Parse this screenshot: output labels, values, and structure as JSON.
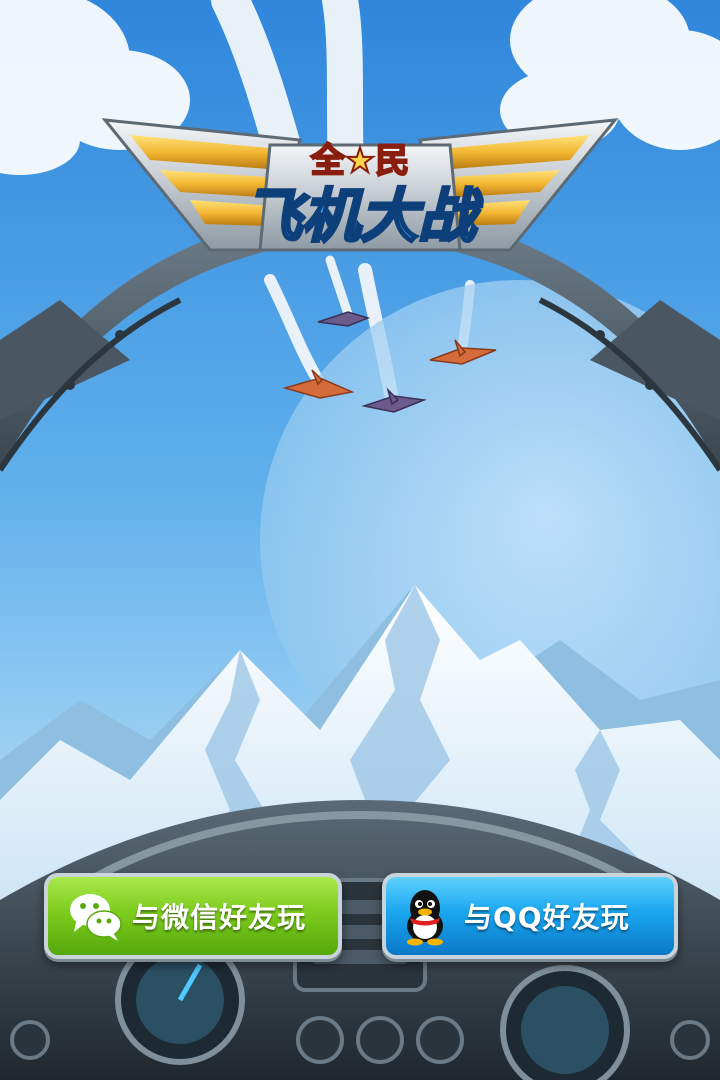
{
  "logo": {
    "subtitle": "全★民",
    "title": "飞机大战"
  },
  "buttons": {
    "wechat": {
      "label": "与微信好友玩",
      "icon": "wechat-icon",
      "color": "#7dcc1e"
    },
    "qq": {
      "label": "与QQ好友玩",
      "icon": "qq-penguin-icon",
      "color": "#1aa6ef"
    }
  },
  "colors": {
    "sky": "#5aa8e6",
    "logo_gold": "#f2b632",
    "logo_blue": "#2a8fe6"
  }
}
